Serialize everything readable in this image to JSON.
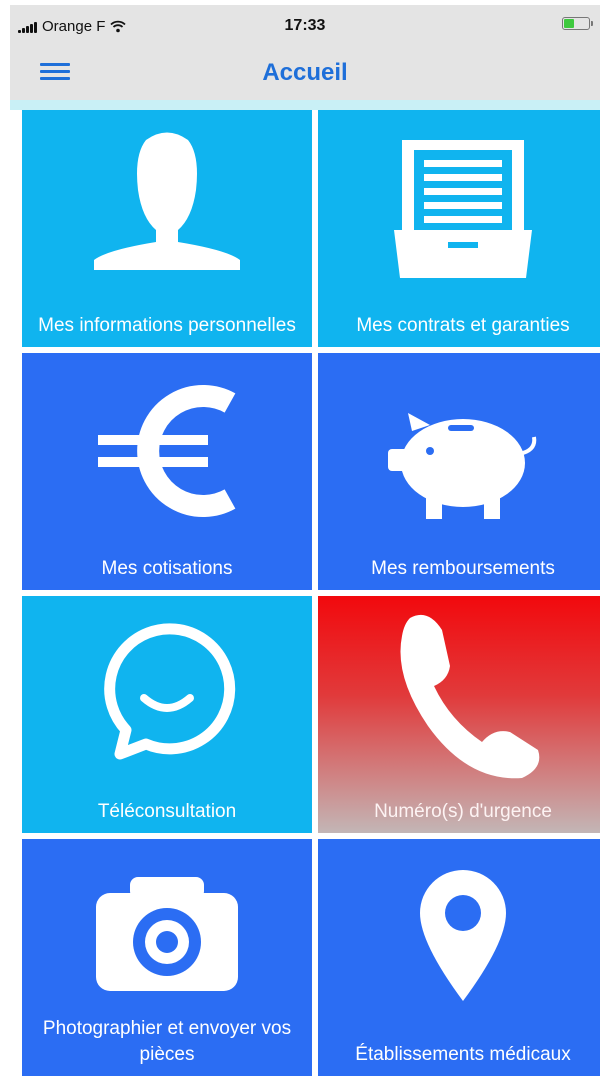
{
  "status_bar": {
    "carrier": "Orange F",
    "time": "17:33"
  },
  "header": {
    "title": "Accueil"
  },
  "tiles": [
    {
      "label": "Mes informations personnelles",
      "icon": "user-icon"
    },
    {
      "label": "Mes contrats et garanties",
      "icon": "file-drawer-icon"
    },
    {
      "label": "Mes cotisations",
      "icon": "euro-icon"
    },
    {
      "label": "Mes remboursements",
      "icon": "piggy-bank-icon"
    },
    {
      "label": "Téléconsultation",
      "icon": "chat-smile-icon"
    },
    {
      "label": "Numéro(s) d'urgence",
      "icon": "phone-icon"
    },
    {
      "label": "Photographier et envoyer vos pièces",
      "icon": "camera-icon"
    },
    {
      "label": "Établissements médicaux",
      "icon": "location-pin-icon"
    }
  ],
  "colors": {
    "status_bar_bg": "#e4e4e4",
    "accent": "#1e6fd9",
    "tile_light": "#10b4ef",
    "tile_dark": "#2b6df3",
    "tile_urgent_red": "#f2090d",
    "battery": "#3ec93e"
  }
}
